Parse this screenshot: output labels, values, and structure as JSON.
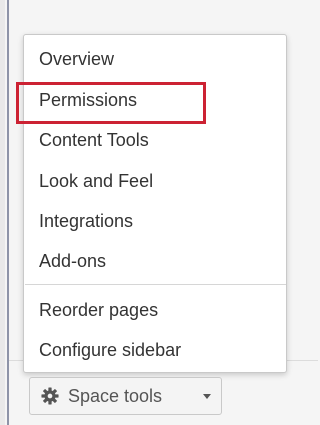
{
  "menu": {
    "items": [
      {
        "label": "Overview"
      },
      {
        "label": "Permissions",
        "highlighted": true
      },
      {
        "label": "Content Tools"
      },
      {
        "label": "Look and Feel"
      },
      {
        "label": "Integrations"
      },
      {
        "label": "Add-ons"
      }
    ],
    "secondary_items": [
      {
        "label": "Reorder pages"
      },
      {
        "label": "Configure sidebar"
      }
    ]
  },
  "space_tools": {
    "label": "Space tools",
    "icon": "gear-icon",
    "caret_icon": "caret-down-icon"
  },
  "colors": {
    "highlight_border": "#cc2233",
    "menu_background": "#ffffff",
    "text": "#333333"
  }
}
